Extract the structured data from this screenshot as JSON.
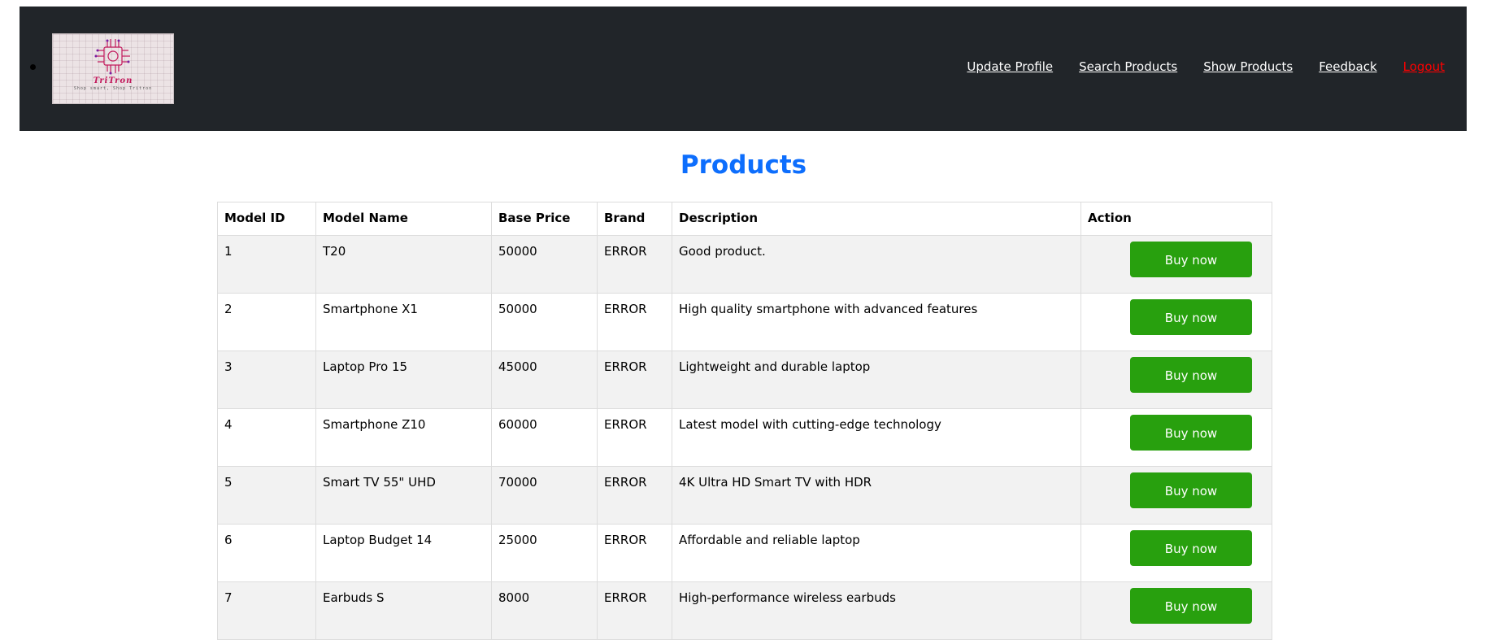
{
  "logo": {
    "name": "TriTron",
    "tagline": "Shop smart, Shop Tritron"
  },
  "nav": {
    "links": [
      "Update Profile",
      "Search Products",
      "Show Products",
      "Feedback"
    ],
    "logout": "Logout"
  },
  "page": {
    "title": "Products"
  },
  "table": {
    "headers": [
      "Model ID",
      "Model Name",
      "Base Price",
      "Brand",
      "Description",
      "Action"
    ],
    "action_label": "Buy now",
    "rows": [
      [
        "1",
        "T20",
        "50000",
        "ERROR",
        "Good product."
      ],
      [
        "2",
        "Smartphone X1",
        "50000",
        "ERROR",
        "High quality smartphone with advanced features"
      ],
      [
        "3",
        "Laptop Pro 15",
        "45000",
        "ERROR",
        "Lightweight and durable laptop"
      ],
      [
        "4",
        "Smartphone Z10",
        "60000",
        "ERROR",
        "Latest model with cutting-edge technology"
      ],
      [
        "5",
        "Smart TV 55\" UHD",
        "70000",
        "ERROR",
        "4K Ultra HD Smart TV with HDR"
      ],
      [
        "6",
        "Laptop Budget 14",
        "25000",
        "ERROR",
        "Affordable and reliable laptop"
      ],
      [
        "7",
        "Earbuds S",
        "8000",
        "ERROR",
        "High-performance wireless earbuds"
      ]
    ]
  },
  "colors": {
    "navbar_bg": "#212529",
    "title": "#0d6efd",
    "button": "#28a00e",
    "logout": "#ff0000",
    "row_stripe": "#f2f2f2"
  }
}
